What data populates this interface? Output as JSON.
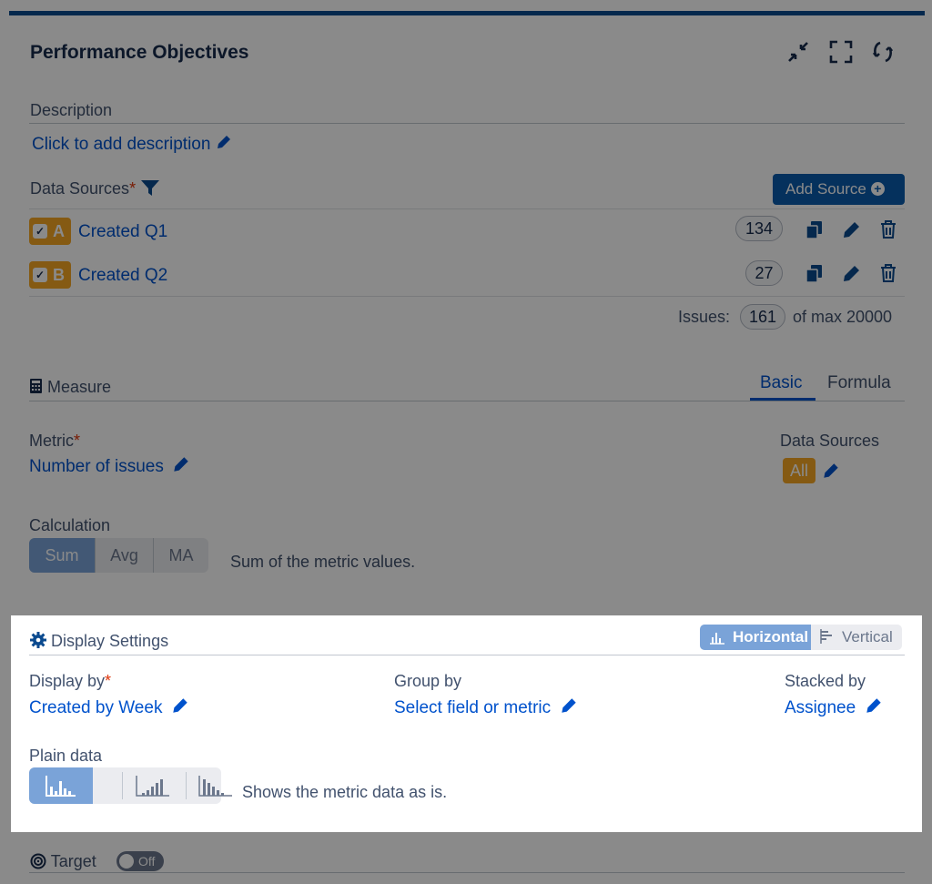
{
  "header": {
    "title": "Performance Objectives",
    "icons": [
      "collapse-icon",
      "fullscreen-icon",
      "refresh-icon"
    ]
  },
  "description": {
    "label": "Description",
    "link": "Click to add description"
  },
  "data_sources": {
    "label": "Data Sources",
    "required_mark": "*",
    "add_button": "Add Source",
    "items": [
      {
        "letter": "A",
        "name": "Created Q1",
        "count": "134"
      },
      {
        "letter": "B",
        "name": "Created Q2",
        "count": "27"
      }
    ],
    "issues_label": "Issues:",
    "issues_count": "161",
    "issues_max": "of max 20000"
  },
  "measure": {
    "label": "Measure",
    "tabs": [
      "Basic",
      "Formula"
    ],
    "metric_label": "Metric",
    "metric_value": "Number of issues",
    "sources_label": "Data Sources",
    "sources_value": "All",
    "calc_label": "Calculation",
    "calc_options": [
      "Sum",
      "Avg",
      "MA"
    ],
    "calc_desc": "Sum of the metric values."
  },
  "display": {
    "label": "Display Settings",
    "orientation": [
      "Horizontal",
      "Vertical"
    ],
    "display_by_label": "Display by",
    "display_by_value": "Created by Week",
    "group_by_label": "Group by",
    "group_by_value": "Select field or metric",
    "stacked_by_label": "Stacked by",
    "stacked_by_value": "Assignee",
    "plain_label": "Plain data",
    "plain_desc": "Shows the metric data as is."
  },
  "target": {
    "label": "Target",
    "toggle": "Off"
  },
  "colors": {
    "accent": "#0052cc",
    "button": "#0b5cad",
    "tag": "#f5a623",
    "selected_segment": "#7aa3d8"
  }
}
